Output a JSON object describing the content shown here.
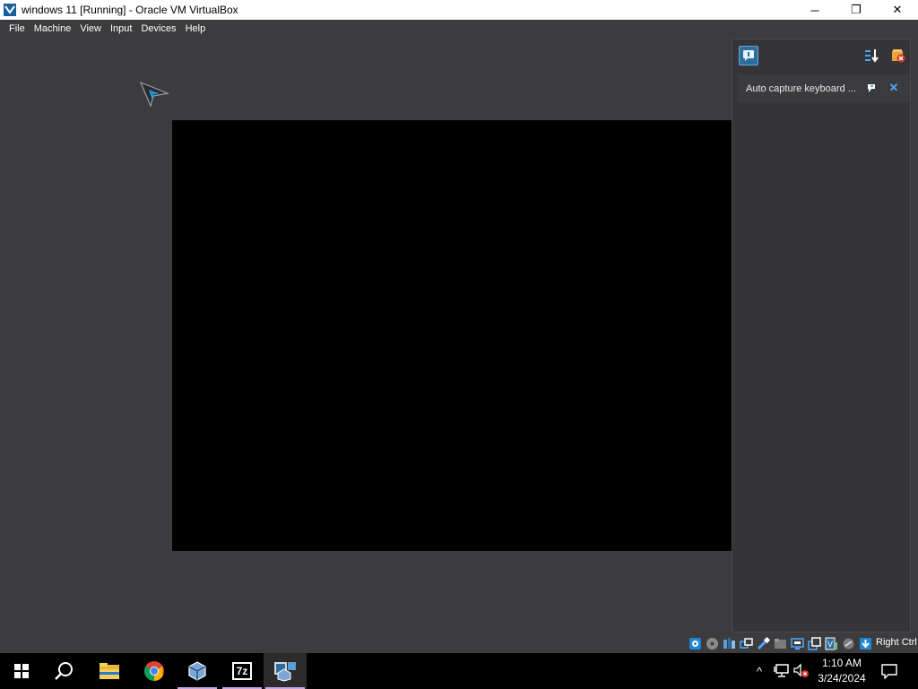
{
  "window": {
    "title": "windows 11 [Running] - Oracle VM VirtualBox",
    "minimize_glyph": "─",
    "maximize_glyph": "❐",
    "close_glyph": "✕"
  },
  "menu": [
    "File",
    "Machine",
    "View",
    "Input",
    "Devices",
    "Help"
  ],
  "notification_panel": {
    "message": "Auto capture keyboard ...",
    "close_glyph": "✕",
    "icons": [
      "info-icon",
      "sort-icon",
      "clear-all-icon",
      "pin-icon",
      "close-icon"
    ]
  },
  "statusbar": {
    "icons": [
      "hard-disk-icon",
      "optical-drive-icon",
      "audio-icon",
      "network-icon",
      "usb-icon",
      "shared-folders-icon",
      "display-icon",
      "recording-icon",
      "video-capture-icon",
      "cpu-activity-icon",
      "mouse-integration-icon",
      "keyboard-capture-icon"
    ],
    "host_key": "Right Ctrl"
  },
  "taskbar": {
    "apps": [
      "start-icon",
      "search-icon",
      "file-explorer-icon",
      "chrome-icon",
      "virtualbox-icon",
      "7zip-icon",
      "virtualbox-vm-icon"
    ],
    "seven_zip_label": "7z",
    "tray_chevron": "^",
    "time": "1:10 AM",
    "date": "3/24/2024"
  },
  "colors": {
    "vbox_background": "#3c3c3e",
    "guest_screen": "#000000",
    "accent_blue": "#4aa8ff",
    "running_indicator": "#c9a6e6"
  }
}
